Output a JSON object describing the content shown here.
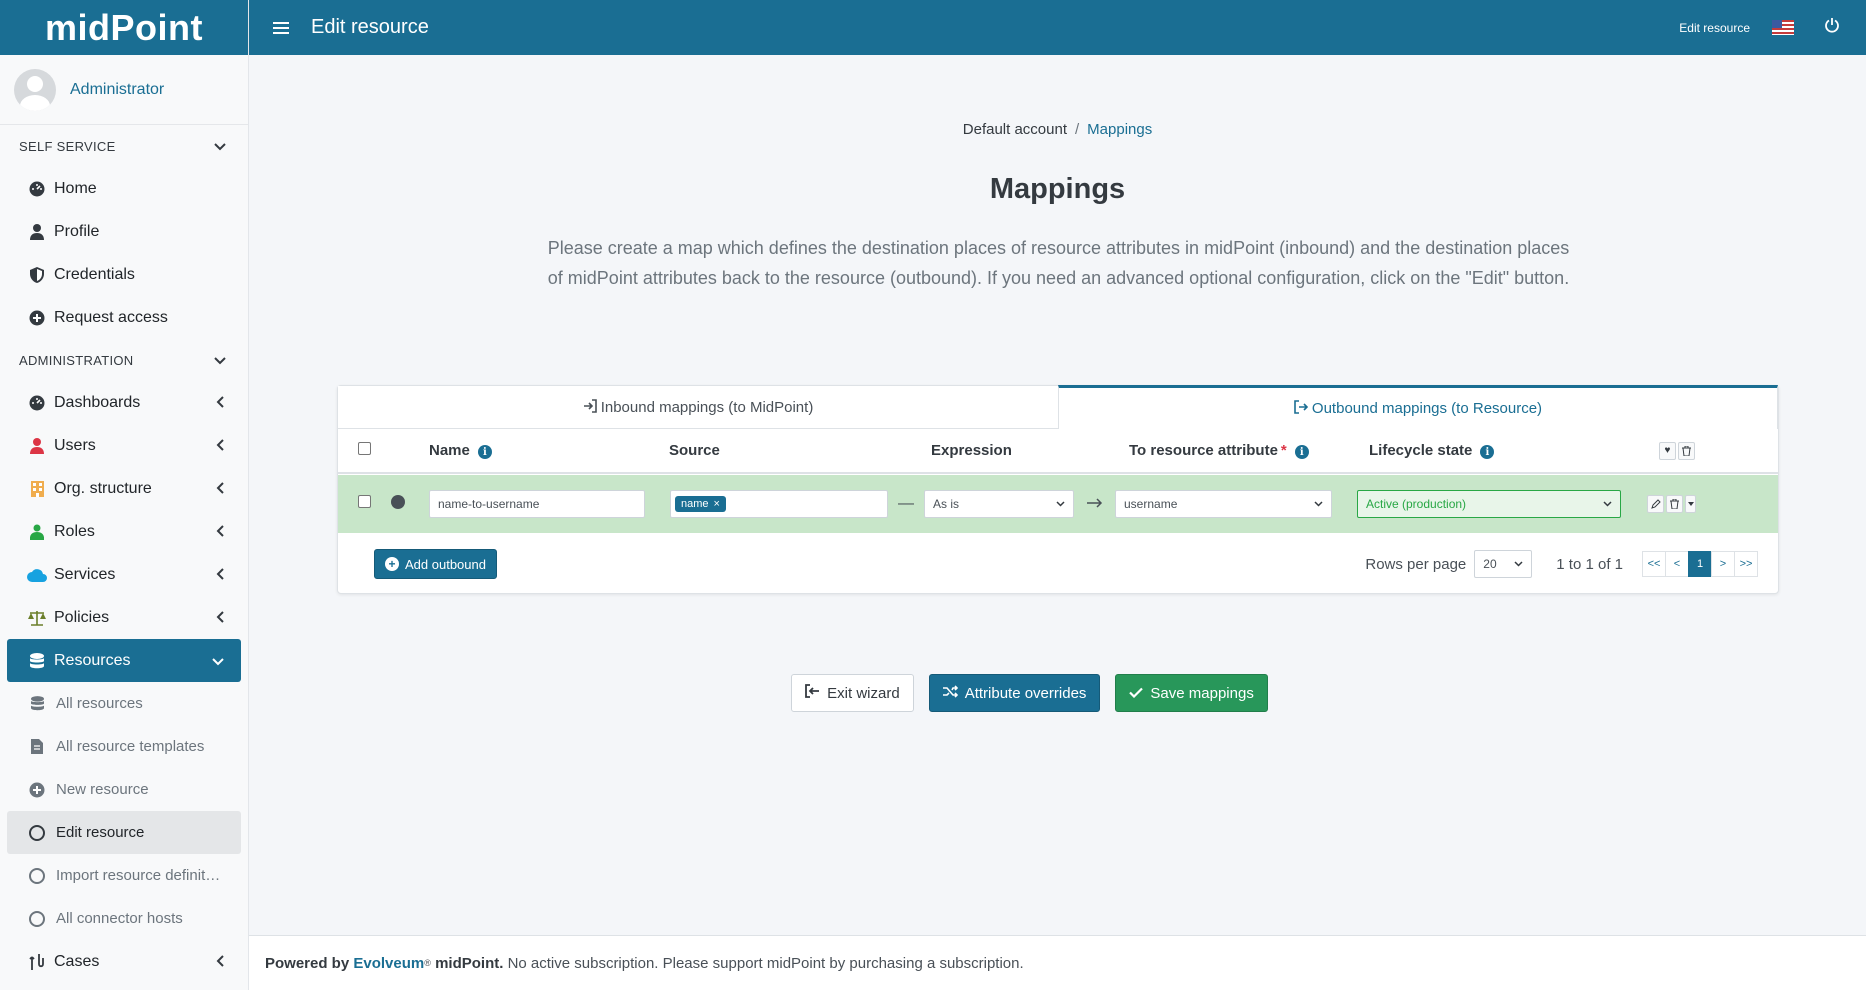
{
  "app": {
    "logo": "midPoint"
  },
  "header": {
    "title": "Edit resource",
    "right_label": "Edit resource"
  },
  "user": {
    "name": "Administrator"
  },
  "sidebar": {
    "self_service_label": "SELF SERVICE",
    "self_service": [
      {
        "label": "Home"
      },
      {
        "label": "Profile"
      },
      {
        "label": "Credentials"
      },
      {
        "label": "Request access"
      }
    ],
    "administration_label": "ADMINISTRATION",
    "administration": [
      {
        "label": "Dashboards"
      },
      {
        "label": "Users"
      },
      {
        "label": "Org. structure"
      },
      {
        "label": "Roles"
      },
      {
        "label": "Services"
      },
      {
        "label": "Policies"
      },
      {
        "label": "Resources"
      }
    ],
    "resources_sub": [
      {
        "label": "All resources"
      },
      {
        "label": "All resource templates"
      },
      {
        "label": "New resource"
      },
      {
        "label": "Edit resource"
      },
      {
        "label": "Import resource definit…"
      },
      {
        "label": "All connector hosts"
      }
    ],
    "cases_label": "Cases"
  },
  "breadcrumb": {
    "first": "Default account",
    "sep": "/",
    "current": "Mappings"
  },
  "main": {
    "title": "Mappings",
    "description": "Please create a map which defines the destination places of resource attributes in midPoint (inbound) and the destination places of midPoint attributes back to the resource (outbound). If you need an advanced optional configuration, click on the \"Edit\" button."
  },
  "tabs": [
    {
      "label": "Inbound mappings (to MidPoint)"
    },
    {
      "label": "Outbound mappings (to Resource)"
    }
  ],
  "table": {
    "columns": {
      "name": "Name",
      "source": "Source",
      "expression": "Expression",
      "target": "To resource attribute",
      "required": "*",
      "lifecycle": "Lifecycle state"
    },
    "row": {
      "name": "name-to-username",
      "source_chip": "name",
      "chip_close": "×",
      "expression": "As is",
      "target": "username",
      "lifecycle": "Active (production)"
    }
  },
  "footer_bar": {
    "add_label": "Add outbound",
    "rows_per_page_label": "Rows per page",
    "rows_per_page": "20",
    "range": "1 to 1 of 1",
    "pager": [
      "<<",
      "<",
      "1",
      ">",
      ">>"
    ]
  },
  "actions": {
    "exit": "Exit wizard",
    "overrides": "Attribute overrides",
    "save": "Save mappings"
  },
  "footer": {
    "powered": "Powered by",
    "brand": "Evolveum",
    "reg": "®",
    "product": "midPoint.",
    "notice": "No active subscription. Please support midPoint by purchasing a subscription."
  }
}
